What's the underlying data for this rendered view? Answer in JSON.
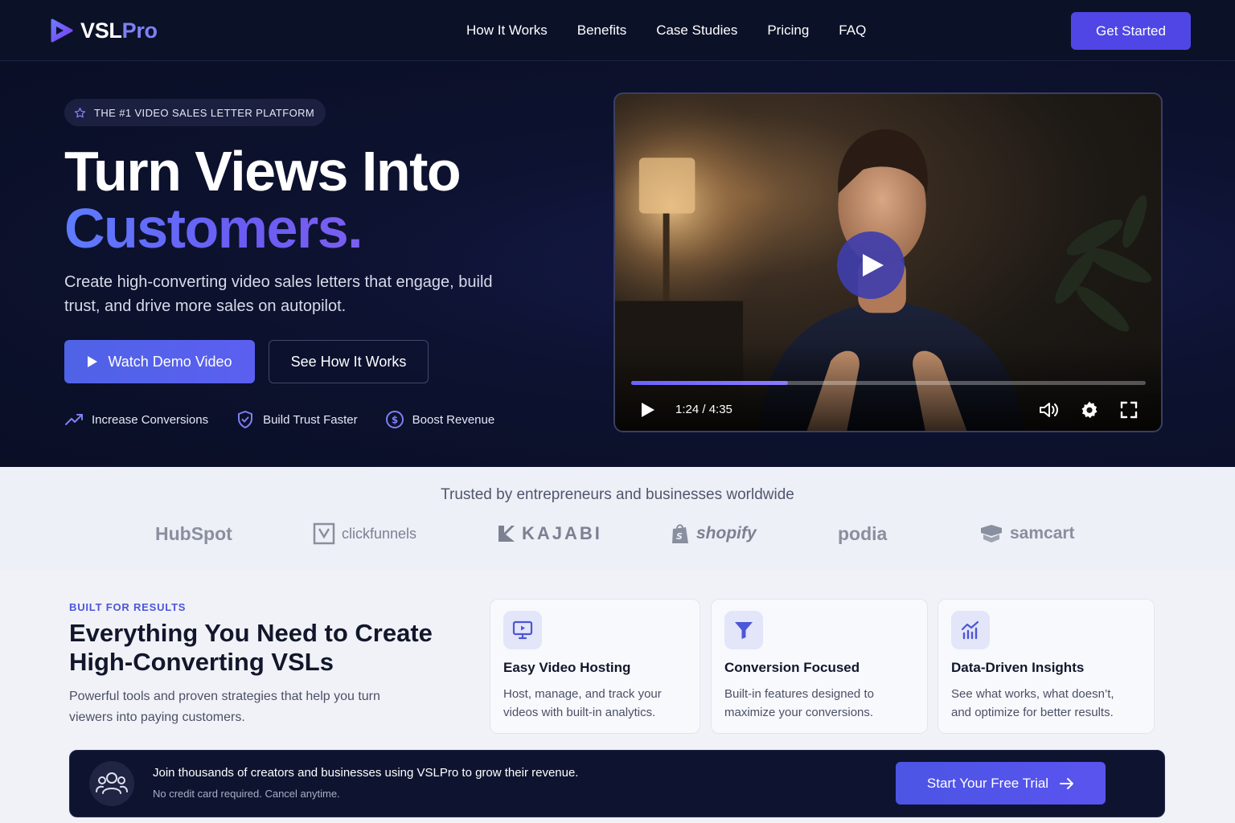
{
  "brand": {
    "name_main": "VSL",
    "name_accent": "Pro"
  },
  "nav": {
    "items": [
      "How It Works",
      "Benefits",
      "Case Studies",
      "Pricing",
      "FAQ"
    ],
    "cta": "Get Started"
  },
  "hero": {
    "badge": "THE #1 VIDEO SALES LETTER PLATFORM",
    "title_line1": "Turn Views Into",
    "title_line2": "Customers.",
    "subtitle": "Create high-converting video sales letters that engage, build trust, and drive more sales on autopilot.",
    "primary_cta": "Watch Demo Video",
    "secondary_cta": "See How It Works",
    "perks": [
      "Increase Conversions",
      "Build Trust Faster",
      "Boost Revenue"
    ]
  },
  "video": {
    "time": "1:24 / 4:35",
    "progress": 0.305
  },
  "trusted": {
    "title": "Trusted by entrepreneurs and businesses worldwide",
    "logos": [
      "HubSpot",
      "clickfunnels",
      "KAJABI",
      "shopify",
      "podia",
      "samcart"
    ]
  },
  "features": {
    "eyebrow": "BUILT FOR RESULTS",
    "title": "Everything You Need to Create High-Converting VSLs",
    "subtitle": "Powerful tools and proven strategies that help you turn viewers into paying customers.",
    "cards": [
      {
        "title": "Easy Video Hosting",
        "text": "Host, manage, and track your videos with built-in analytics."
      },
      {
        "title": "Conversion Focused",
        "text": "Built-in features designed to maximize your conversions."
      },
      {
        "title": "Data-Driven Insights",
        "text": "See what works, what doesn’t, and optimize for better results."
      }
    ]
  },
  "cta_bar": {
    "title": "Join thousands of creators and businesses using VSLPro to grow their revenue.",
    "subtitle": "No credit card required. Cancel anytime.",
    "button": "Start Your Free Trial"
  },
  "colors": {
    "accent": "#4f46e5",
    "hero_bg": "#0b1127",
    "light_bg": "#eef0f7",
    "brand_accent": "#7d80f5"
  }
}
